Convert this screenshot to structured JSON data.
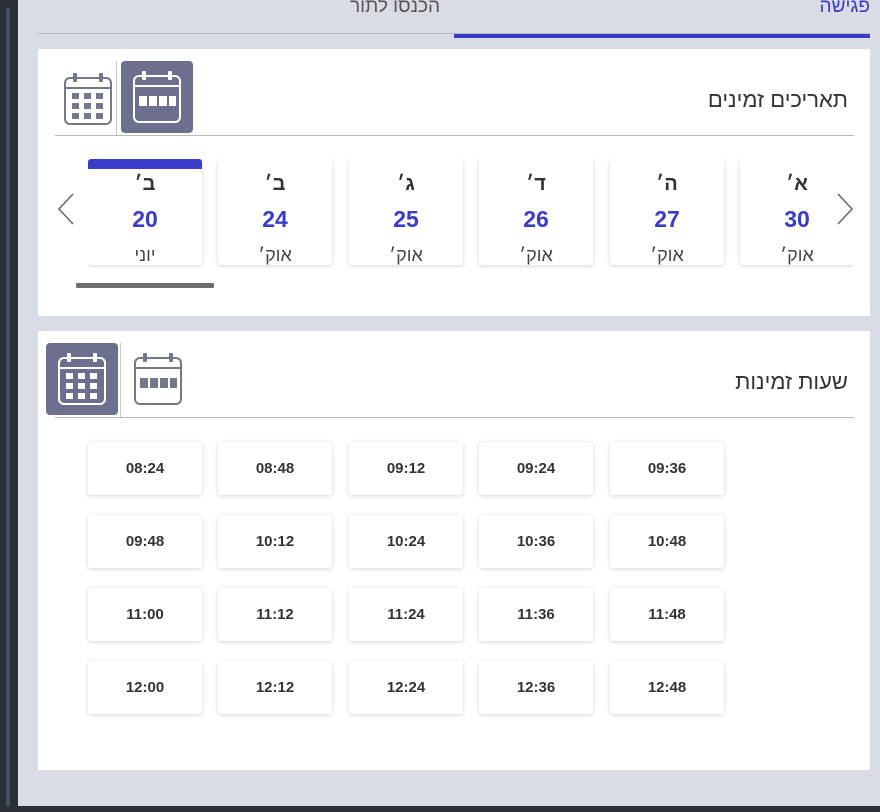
{
  "tabs": [
    {
      "label": "פגישה"
    },
    {
      "label": "הכנסו לתור"
    }
  ],
  "dates_section": {
    "title": "תאריכים זמינים",
    "dates": [
      {
        "day": "א׳",
        "num": "30",
        "month": "אוק׳"
      },
      {
        "day": "ה׳",
        "num": "27",
        "month": "אוק׳"
      },
      {
        "day": "ד׳",
        "num": "26",
        "month": "אוק׳"
      },
      {
        "day": "ג׳",
        "num": "25",
        "month": "אוק׳"
      },
      {
        "day": "ב׳",
        "num": "24",
        "month": "אוק׳"
      },
      {
        "day": "ב׳",
        "num": "20",
        "month": "יוני"
      }
    ]
  },
  "times_section": {
    "title": "שעות זמינות",
    "times": [
      "08:24",
      "08:48",
      "09:12",
      "09:24",
      "09:36",
      "09:48",
      "10:12",
      "10:24",
      "10:36",
      "10:48",
      "11:00",
      "11:12",
      "11:24",
      "11:36",
      "11:48",
      "12:00",
      "12:12",
      "12:24",
      "12:36",
      "12:48"
    ]
  },
  "colors": {
    "accent": "#3b3bc9",
    "active_view_bg": "#6c6f8e",
    "page_bg": "#d9dbe5"
  },
  "icons": {
    "month_view": "calendar-grid-icon",
    "week_view": "calendar-week-icon",
    "prev": "chevron-left-icon",
    "next": "chevron-right-icon"
  }
}
